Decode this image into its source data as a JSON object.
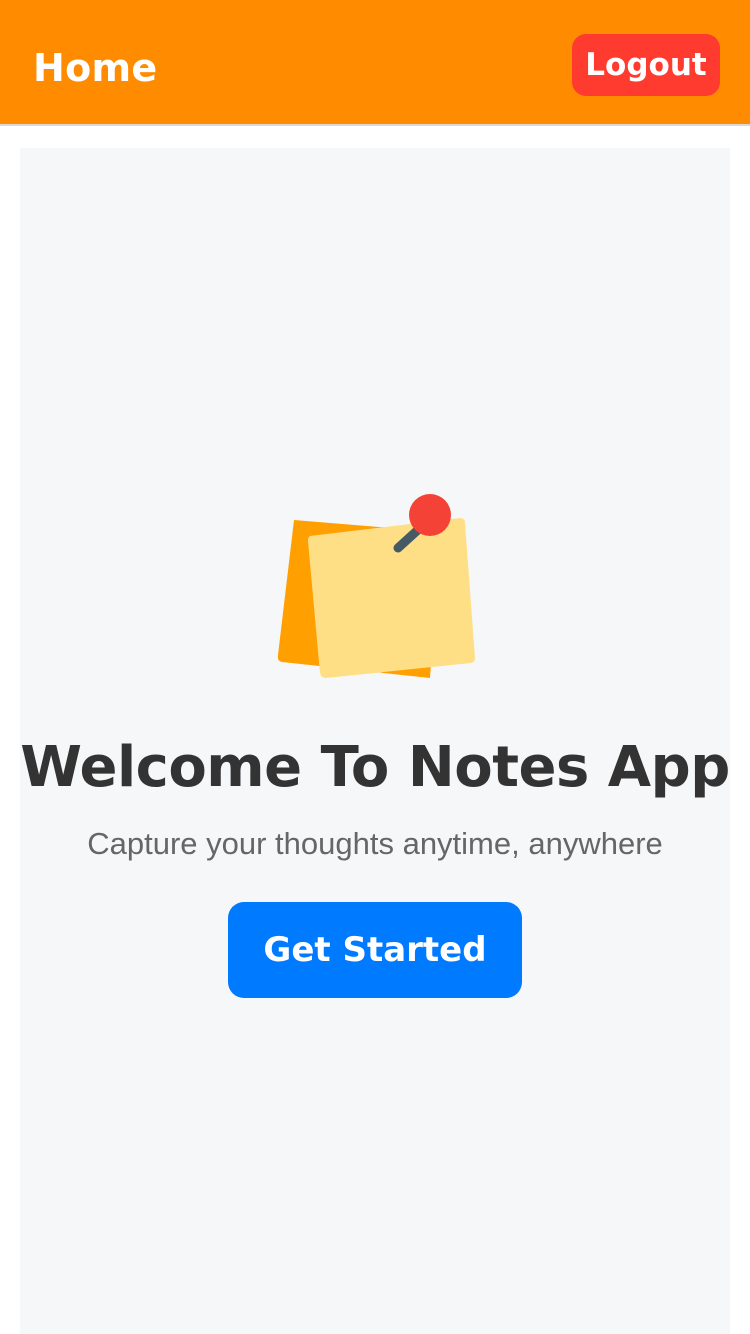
{
  "header": {
    "title": "Home",
    "logout_label": "Logout",
    "background_color": "#FF8C00",
    "logout_color": "#FF3B30"
  },
  "main": {
    "illustration_icon": "sticky-notes-pin-icon",
    "title": "Welcome To Notes App",
    "subtitle": "Capture your thoughts anytime, anywhere",
    "cta_label": "Get Started",
    "cta_color": "#007BFF",
    "card_background": "#F6F7F9"
  }
}
